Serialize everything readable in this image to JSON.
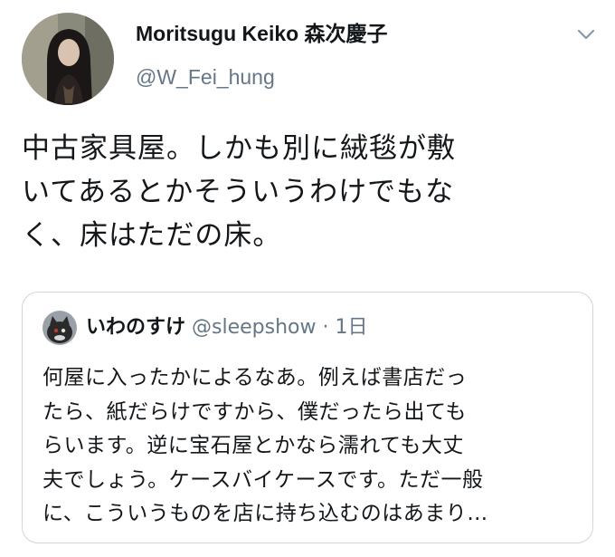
{
  "author": {
    "display_name": "Moritsugu Keiko 森次慶子",
    "handle": "@W_Fei_hung",
    "avatar_icon": "profile-photo-woman-long-dark-hair"
  },
  "menu": {
    "icon": "chevron-down-icon"
  },
  "tweet": {
    "text": "中古家具屋。しかも別に絨毯が敷\nいてあるとかそういうわけでもな\nく、床はただの床。"
  },
  "quoted_tweet": {
    "display_name": "いわのすけ",
    "handle": "@sleepshow",
    "separator": "·",
    "time": "1日",
    "avatar_icon": "profile-photo-cat",
    "text": "何屋に入ったかによるなあ。例えば書店だっ\nたら、紙だらけですから、僕だったら出ても\nらいます。逆に宝石屋とかなら濡れても大丈\n夫でしょう。ケースバイケースです。ただ一般\nに、こういうものを店に持ち込むのはあまり…"
  },
  "colors": {
    "text_primary": "#14171a",
    "text_secondary": "#657786",
    "border": "#ccd6dd",
    "background": "#ffffff"
  }
}
